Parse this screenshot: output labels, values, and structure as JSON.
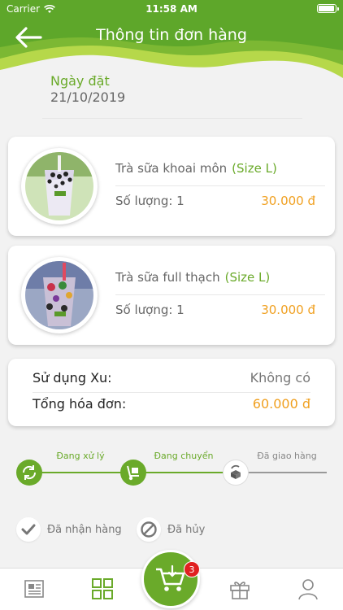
{
  "status_bar": {
    "carrier": "Carrier",
    "time": "11:58 AM"
  },
  "header": {
    "title": "Thông tin đơn hàng"
  },
  "order": {
    "date_label": "Ngày đặt",
    "date_value": "21/10/2019"
  },
  "items": [
    {
      "name": "Trà sữa khoai môn",
      "size": "(Size L)",
      "quantity": "Số lượng: 1",
      "price": "30.000 đ"
    },
    {
      "name": "Trà sữa full thạch",
      "size": "(Size L)",
      "quantity": "Số lượng: 1",
      "price": "30.000 đ"
    }
  ],
  "summary": {
    "xu_label": "Sử dụng Xu:",
    "xu_value": "Không có",
    "total_label": "Tổng hóa đơn:",
    "total_value": "60.000 đ"
  },
  "tracker": {
    "steps": [
      {
        "label": "Đang xử lý",
        "status": "done"
      },
      {
        "label": "Đang chuyển",
        "status": "done"
      },
      {
        "label": "Đã giao hàng",
        "status": "pending"
      }
    ]
  },
  "actions": {
    "received_label": "Đã nhận hàng",
    "cancelled_label": "Đã hủy"
  },
  "tabbar": {
    "cart_badge": "3",
    "items": [
      "news-icon",
      "grid-icon",
      "cart-icon",
      "gift-icon",
      "user-icon"
    ]
  },
  "colors": {
    "brand_green": "#6aaa2a",
    "price_orange": "#f0a020",
    "badge_red": "#e02020"
  }
}
